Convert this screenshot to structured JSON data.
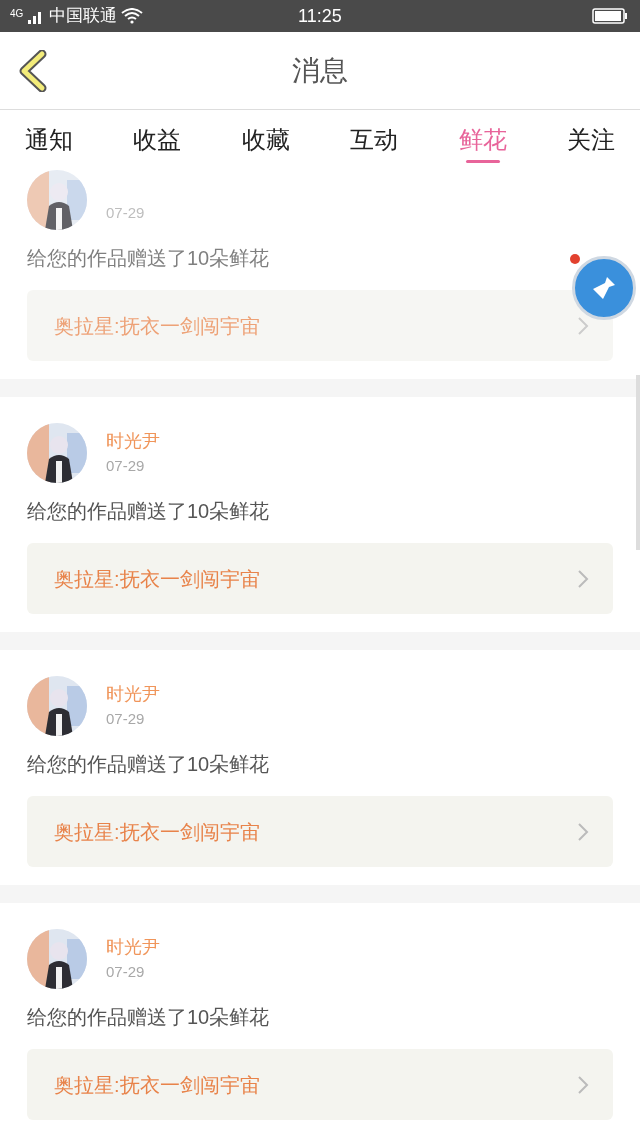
{
  "status_bar": {
    "network": "4G",
    "carrier": "中国联通",
    "time": "11:25"
  },
  "header": {
    "title": "消息"
  },
  "tabs": [
    {
      "label": "通知",
      "selected": false
    },
    {
      "label": "收益",
      "selected": false
    },
    {
      "label": "收藏",
      "selected": false
    },
    {
      "label": "互动",
      "selected": false
    },
    {
      "label": "鲜花",
      "selected": true
    },
    {
      "label": "关注",
      "selected": false
    }
  ],
  "messages": [
    {
      "dimmed": true,
      "date": "07-29",
      "text": "给您的作品赠送了10朵鲜花",
      "work": "奥拉星:抚衣一剑闯宇宙"
    },
    {
      "dimmed": false,
      "name": "时光尹",
      "date": "07-29",
      "text": "给您的作品赠送了10朵鲜花",
      "work": "奥拉星:抚衣一剑闯宇宙"
    },
    {
      "dimmed": false,
      "name": "时光尹",
      "date": "07-29",
      "text": "给您的作品赠送了10朵鲜花",
      "work": "奥拉星:抚衣一剑闯宇宙"
    },
    {
      "dimmed": false,
      "name": "时光尹",
      "date": "07-29",
      "text": "给您的作品赠送了10朵鲜花",
      "work": "奥拉星:抚衣一剑闯宇宙"
    }
  ]
}
